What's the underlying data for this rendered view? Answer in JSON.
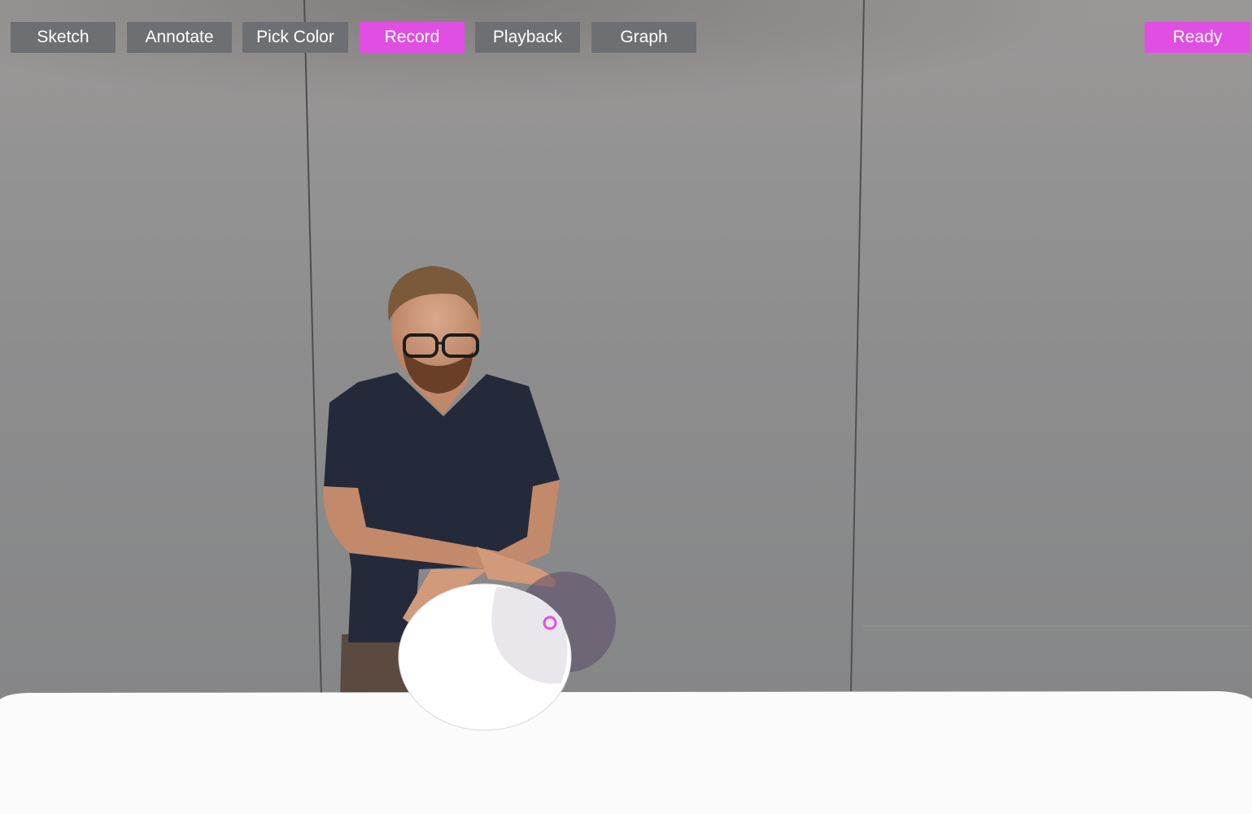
{
  "toolbar": {
    "sketch_label": "Sketch",
    "annotate_label": "Annotate",
    "pick_color_label": "Pick Color",
    "record_label": "Record",
    "playback_label": "Playback",
    "graph_label": "Graph"
  },
  "status": {
    "label": "Ready"
  },
  "colors": {
    "accent": "#e14ee4",
    "button_gray": "#6e6f72",
    "wall": "#8c8c8c",
    "table": "#fafafa",
    "shirt": "#232838"
  }
}
